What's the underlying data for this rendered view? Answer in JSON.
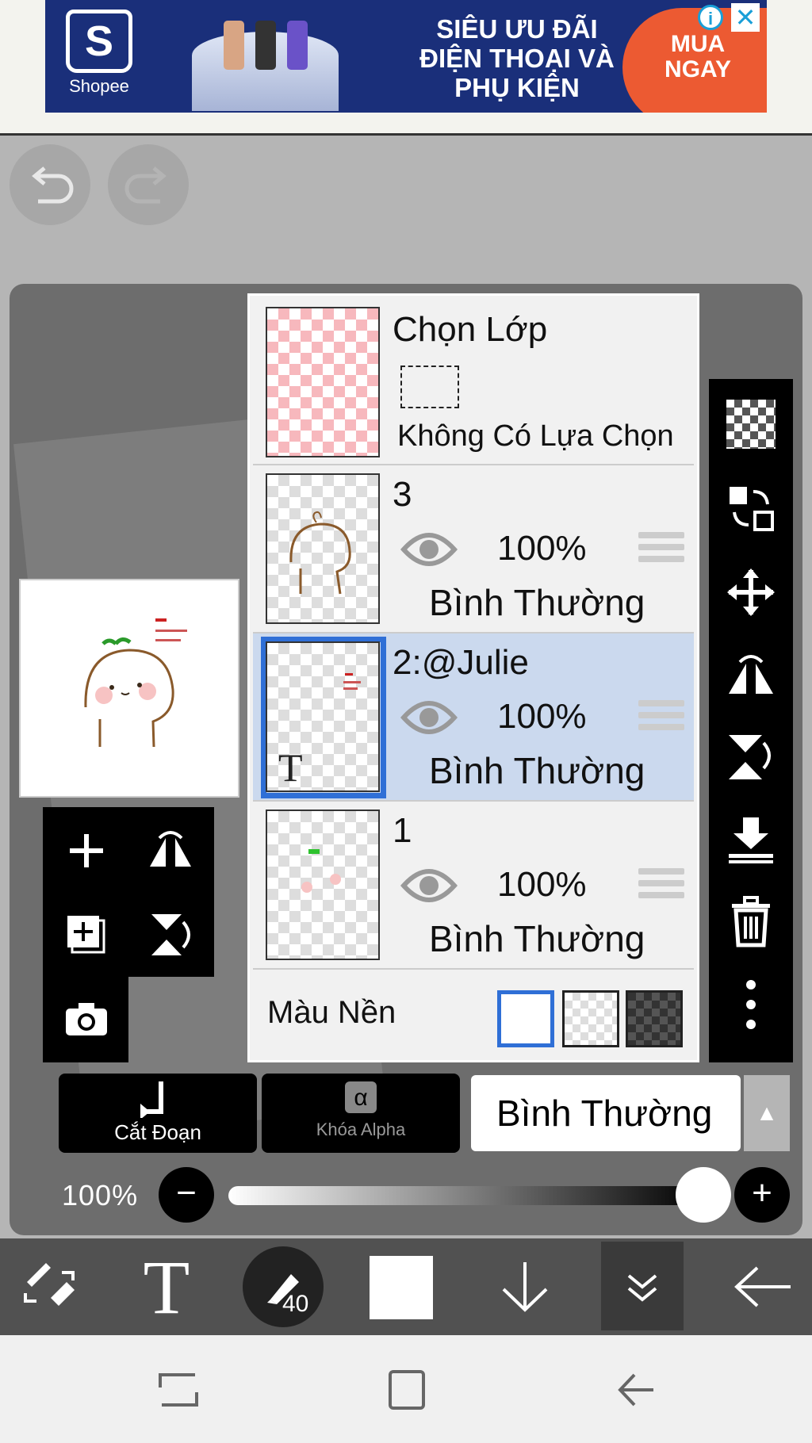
{
  "ad": {
    "brand": "Shopee",
    "brand_letter": "S",
    "headline_1": "SIÊU ƯU ĐÃI",
    "headline_2": "ĐIỆN THOẠI VÀ",
    "headline_3": "PHỤ KIỆN",
    "cta_1": "MUA",
    "cta_2": "NGAY",
    "info_label": "i",
    "close_label": "✕",
    "colors": {
      "background": "#1a2f7a",
      "cta": "#ec5a32"
    }
  },
  "layers": {
    "selection": {
      "title": "Chọn Lớp",
      "status": "Không Có Lựa Chọn"
    },
    "items": [
      {
        "name": "3",
        "opacity": "100%",
        "blend": "Bình Thường",
        "selected": false
      },
      {
        "name": "2:@Julie",
        "opacity": "100%",
        "blend": "Bình Thường",
        "selected": true,
        "type_badge": "T"
      },
      {
        "name": "1",
        "opacity": "100%",
        "blend": "Bình Thường",
        "selected": false
      }
    ],
    "background": {
      "label": "Màu Nền",
      "options": [
        "white",
        "transparent",
        "dark-checker"
      ],
      "selected": "white"
    }
  },
  "controls": {
    "clip_label": "Cắt Đoạn",
    "alpha_lock_label": "Khóa Alpha",
    "alpha_symbol": "α",
    "blend_mode": "Bình Thường",
    "opacity_label": "100%",
    "opacity_value": 1.0,
    "minus": "−",
    "plus": "+"
  },
  "toolbar": {
    "brush_size": "40",
    "text_tool": "T"
  },
  "colors": {
    "selected_row": "#cbd9ee",
    "selection_border": "#2f6fd6"
  }
}
